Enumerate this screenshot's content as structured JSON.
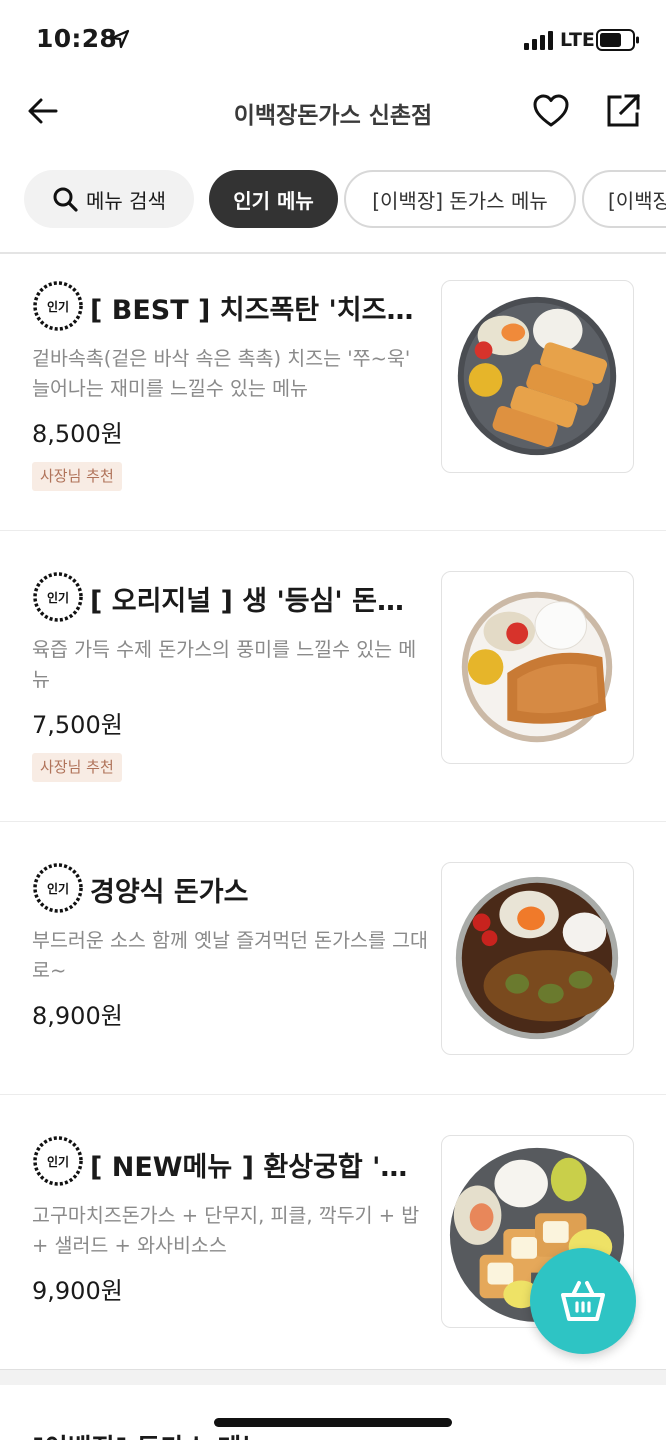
{
  "status_bar": {
    "time": "10:28",
    "network": "LTE"
  },
  "header": {
    "title": "이백장돈가스 신촌점"
  },
  "tabs": [
    {
      "label": "메뉴 검색"
    },
    {
      "label": "인기 메뉴"
    },
    {
      "label": "[이백장] 돈가스 메뉴"
    },
    {
      "label": "[이백장"
    }
  ],
  "badge_text": "인기",
  "items": [
    {
      "name": "[ BEST ] 치즈폭탄 '치즈'...",
      "description": "겉바속촉(겉은 바삭 속은 촉촉) 치즈는 '쭈~욱' 늘어나는 재미를 느낄수 있는 메뉴",
      "price": "8,500원",
      "tag": "사장님 추천"
    },
    {
      "name": "[ 오리지널 ] 생 '등심' 돈가...",
      "description": "육즙 가득 수제 돈가스의 풍미를 느낄수 있는 메뉴",
      "price": "7,500원",
      "tag": "사장님 추천"
    },
    {
      "name": "경양식 돈가스",
      "description": "부드러운 소스 함께 옛날 즐겨먹던 돈가스를 그대로~",
      "price": "8,900원"
    },
    {
      "name": "[ NEW메뉴 ] 환상궁합 '고...",
      "description": "고구마치즈돈가스 + 단무지, 피클, 깍두기 + 밥 + 샐러드 + 와사비소스",
      "price": "9,900원"
    }
  ],
  "peek_text": "[이백장] 돈가스 메뉴",
  "colors": {
    "accent": "#2ec4c4",
    "tab_active": "#333333",
    "tag_bg": "#f8ece4",
    "tag_text": "#b0735a"
  },
  "icons": [
    "back-arrow-icon",
    "heart-icon",
    "share-icon",
    "search-icon",
    "cart-icon",
    "popular-badge-icon"
  ]
}
